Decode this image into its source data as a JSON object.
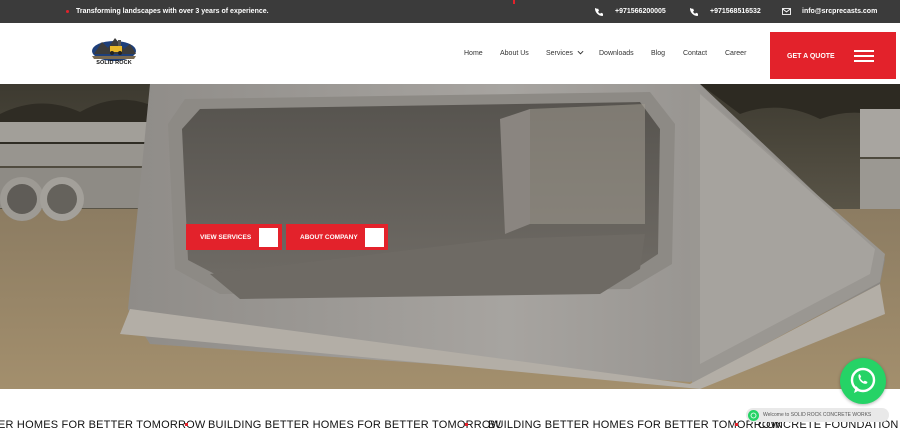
{
  "topbar": {
    "tagline": "Transforming landscapes with over 3 years of experience.",
    "phone1": "+971566200005",
    "phone2": "+971568516532",
    "email": "info@srcprecasts.com",
    "icons": [
      "phone-icon",
      "phone-icon",
      "mail-icon"
    ]
  },
  "header": {
    "logo_text": "SOLID ROCK",
    "nav": {
      "home": "Home",
      "about": "About Us",
      "services": "Services",
      "downloads": "Downloads",
      "blog": "Blog",
      "contact": "Contact",
      "career": "Career"
    },
    "quote_label": "GET A QUOTE"
  },
  "hero": {
    "view_services": "VIEW SERVICES",
    "about_company": "ABOUT COMPANY"
  },
  "marquee": {
    "item1": "ER HOMES FOR BETTER TOMORROW",
    "item2": "BUILDING BETTER HOMES FOR BETTER TOMORROW",
    "item3": "BUILDING BETTER HOMES FOR BETTER TOMORROW",
    "item4": "CONCRETE FOUNDATION CONT"
  },
  "whatsapp": {
    "bubble_text": "Welcome to SOLID ROCK CONCRETE WORKS"
  },
  "colors": {
    "accent": "#e3222b",
    "topbar": "#3b3b3b",
    "whatsapp": "#25d366"
  }
}
